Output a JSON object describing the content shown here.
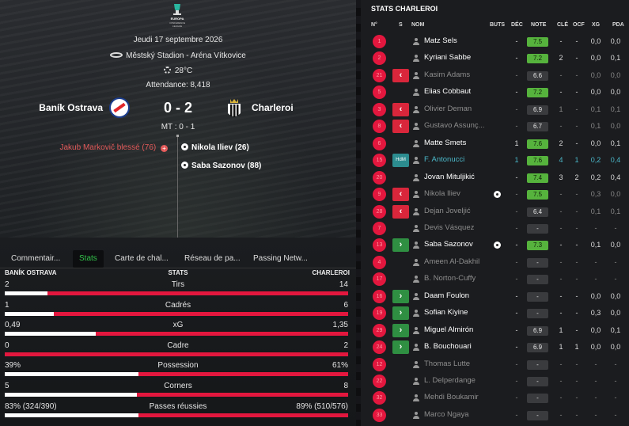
{
  "match": {
    "competition_logo": "uefa-europa-conference-league-logo",
    "date": "Jeudi 17 septembre 2026",
    "stadium": "Městský Stadion - Aréna Vítkovice",
    "temperature": "28°C",
    "attendance": "Attendance: 8,418",
    "home_team": "Baník Ostrava",
    "away_team": "Charleroi",
    "score": "0 - 2",
    "halftime": "MT : 0 - 1",
    "home_events": [
      {
        "text": "Jakub Markovič blessé (76)",
        "type": "injury"
      }
    ],
    "away_events": [
      {
        "text": "Nikola Iliev (26)",
        "type": "goal"
      },
      {
        "text": "Saba Sazonov (88)",
        "type": "goal"
      }
    ]
  },
  "tabs": [
    "Commentair...",
    "Stats",
    "Carte de chal...",
    "Réseau de pa...",
    "Passing Netw..."
  ],
  "active_tab": "Stats",
  "stats": {
    "home_header": "BANÍK OSTRAVA",
    "center_header": "STATS",
    "away_header": "CHARLEROI",
    "rows": [
      {
        "label": "Tirs",
        "home": "2",
        "away": "14",
        "home_share": 0.125
      },
      {
        "label": "Cadrés",
        "home": "1",
        "away": "6",
        "home_share": 0.143
      },
      {
        "label": "xG",
        "home": "0,49",
        "away": "1,35",
        "home_share": 0.266
      },
      {
        "label": "Cadre",
        "home": "0",
        "away": "2",
        "home_share": 0.0
      },
      {
        "label": "Possession",
        "home": "39%",
        "away": "61%",
        "home_share": 0.39
      },
      {
        "label": "Corners",
        "home": "5",
        "away": "8",
        "home_share": 0.385
      },
      {
        "label": "Passes réussies",
        "home": "83% (324/390)",
        "away": "89% (510/576)",
        "home_share": 0.39
      }
    ]
  },
  "player_stats": {
    "title": "STATS CHARLEROI",
    "columns": {
      "num": "N°",
      "sub": "S",
      "name": "NOM",
      "goals": "BUTS",
      "dec": "DÉC",
      "rating": "NOTE",
      "key": "CLÉ",
      "ocf": "OCF",
      "xg": "XG",
      "pda": "PDA"
    },
    "players": [
      {
        "num": "1",
        "sub": "",
        "name": "Matz Sels",
        "goals": "",
        "dec": "-",
        "rating": "7.5",
        "good": true,
        "key": "-",
        "ocf": "-",
        "xg": "0,0",
        "pda": "0,0",
        "dim": false
      },
      {
        "num": "2",
        "sub": "",
        "name": "Kyriani Sabbe",
        "goals": "",
        "dec": "-",
        "rating": "7.2",
        "good": true,
        "key": "2",
        "ocf": "-",
        "xg": "0,0",
        "pda": "0,1",
        "dim": false
      },
      {
        "num": "21",
        "sub": "out",
        "name": "Kasim Adams",
        "goals": "",
        "dec": "-",
        "rating": "6.6",
        "good": false,
        "key": "-",
        "ocf": "-",
        "xg": "0,0",
        "pda": "0,0",
        "dim": true
      },
      {
        "num": "5",
        "sub": "",
        "name": "Elias Cobbaut",
        "goals": "",
        "dec": "-",
        "rating": "7.2",
        "good": true,
        "key": "-",
        "ocf": "-",
        "xg": "0,0",
        "pda": "0,0",
        "dim": false
      },
      {
        "num": "3",
        "sub": "out",
        "name": "Olivier Deman",
        "goals": "",
        "dec": "-",
        "rating": "6.9",
        "good": false,
        "key": "1",
        "ocf": "-",
        "xg": "0,1",
        "pda": "0,1",
        "dim": true
      },
      {
        "num": "8",
        "sub": "out",
        "name": "Gustavo Assunç...",
        "goals": "",
        "dec": "-",
        "rating": "6.7",
        "good": false,
        "key": "-",
        "ocf": "-",
        "xg": "0,1",
        "pda": "0,0",
        "dim": true
      },
      {
        "num": "6",
        "sub": "",
        "name": "Matte Smets",
        "goals": "",
        "dec": "1",
        "rating": "7.6",
        "good": true,
        "key": "2",
        "ocf": "-",
        "xg": "0,0",
        "pda": "0,1",
        "dim": false
      },
      {
        "num": "15",
        "sub": "hdm",
        "name": "F. Antonucci",
        "goals": "",
        "dec": "1",
        "rating": "7.6",
        "good": true,
        "key": "4",
        "ocf": "1",
        "xg": "0,2",
        "pda": "0,4",
        "dim": false,
        "highlight": true
      },
      {
        "num": "20",
        "sub": "",
        "name": "Jovan Mituljikić",
        "goals": "",
        "dec": "-",
        "rating": "7.4",
        "good": true,
        "key": "3",
        "ocf": "2",
        "xg": "0,2",
        "pda": "0,4",
        "dim": false
      },
      {
        "num": "9",
        "sub": "out",
        "name": "Nikola Iliev",
        "goals": "1",
        "dec": "-",
        "rating": "7.5",
        "good": true,
        "key": "-",
        "ocf": "-",
        "xg": "0,3",
        "pda": "0,0",
        "dim": true
      },
      {
        "num": "28",
        "sub": "out",
        "name": "Dejan Joveljić",
        "goals": "",
        "dec": "-",
        "rating": "6.4",
        "good": false,
        "key": "-",
        "ocf": "-",
        "xg": "0,1",
        "pda": "0,1",
        "dim": true
      },
      {
        "num": "7",
        "sub": "",
        "name": "Devis Vásquez",
        "goals": "",
        "dec": "-",
        "rating": "-",
        "good": false,
        "key": "-",
        "ocf": "-",
        "xg": "-",
        "pda": "-",
        "dim": true
      },
      {
        "num": "13",
        "sub": "in",
        "name": "Saba Sazonov",
        "goals": "1",
        "dec": "-",
        "rating": "7.3",
        "good": true,
        "key": "-",
        "ocf": "-",
        "xg": "0,1",
        "pda": "0,0",
        "dim": false
      },
      {
        "num": "4",
        "sub": "",
        "name": "Ameen Al-Dakhil",
        "goals": "",
        "dec": "-",
        "rating": "-",
        "good": false,
        "key": "-",
        "ocf": "-",
        "xg": "-",
        "pda": "-",
        "dim": true
      },
      {
        "num": "17",
        "sub": "",
        "name": "B. Norton-Cuffy",
        "goals": "",
        "dec": "-",
        "rating": "-",
        "good": false,
        "key": "-",
        "ocf": "-",
        "xg": "-",
        "pda": "-",
        "dim": true
      },
      {
        "num": "16",
        "sub": "in",
        "name": "Daam Foulon",
        "goals": "",
        "dec": "-",
        "rating": "-",
        "good": false,
        "key": "-",
        "ocf": "-",
        "xg": "0,0",
        "pda": "0,0",
        "dim": false
      },
      {
        "num": "19",
        "sub": "in",
        "name": "Sofian Kiyine",
        "goals": "",
        "dec": "-",
        "rating": "-",
        "good": false,
        "key": "-",
        "ocf": "-",
        "xg": "0,3",
        "pda": "0,0",
        "dim": false
      },
      {
        "num": "29",
        "sub": "in",
        "name": "Miguel Almirón",
        "goals": "",
        "dec": "-",
        "rating": "6.9",
        "good": false,
        "key": "1",
        "ocf": "-",
        "xg": "0,0",
        "pda": "0,1",
        "dim": false
      },
      {
        "num": "24",
        "sub": "in",
        "name": "B. Bouchouari",
        "goals": "",
        "dec": "-",
        "rating": "6.9",
        "good": false,
        "key": "1",
        "ocf": "1",
        "xg": "0,0",
        "pda": "0,0",
        "dim": false
      },
      {
        "num": "12",
        "sub": "",
        "name": "Thomas Lutte",
        "goals": "",
        "dec": "-",
        "rating": "-",
        "good": false,
        "key": "-",
        "ocf": "-",
        "xg": "-",
        "pda": "-",
        "dim": true
      },
      {
        "num": "22",
        "sub": "",
        "name": "L. Delperdange",
        "goals": "",
        "dec": "-",
        "rating": "-",
        "good": false,
        "key": "-",
        "ocf": "-",
        "xg": "-",
        "pda": "-",
        "dim": true
      },
      {
        "num": "32",
        "sub": "",
        "name": "Mehdi Boukamir",
        "goals": "",
        "dec": "-",
        "rating": "-",
        "good": false,
        "key": "-",
        "ocf": "-",
        "xg": "-",
        "pda": "-",
        "dim": true
      },
      {
        "num": "33",
        "sub": "",
        "name": "Marco Ngaya",
        "goals": "",
        "dec": "-",
        "rating": "-",
        "good": false,
        "key": "-",
        "ocf": "-",
        "xg": "-",
        "pda": "-",
        "dim": true
      }
    ]
  },
  "colors": {
    "accent_red": "#e3173e",
    "rating_good": "#56b33d",
    "sub_out": "#d9263b",
    "sub_in": "#2f8f42",
    "active_tab": "#33c24a",
    "highlight": "#4bb8c9"
  }
}
